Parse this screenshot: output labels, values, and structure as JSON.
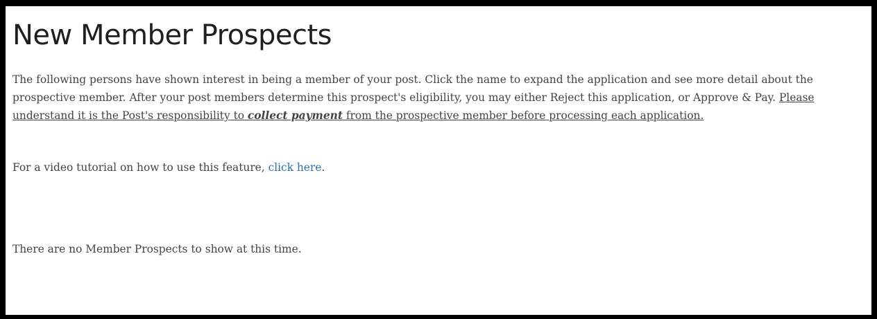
{
  "page": {
    "title": "New Member Prospects",
    "intro_plain": "The following persons have shown interest in being a member of your post. Click the name to expand the application and see more detail about the prospective member. After your post members determine this prospect's eligibility, you may either Reject this application, or Approve & Pay. ",
    "intro_underline_before": "Please understand it is the Post's responsibility to ",
    "intro_emphasis": "collect payment",
    "intro_underline_after": " from the prospective member before processing each application.",
    "tutorial_prefix": "For a video tutorial on how to use this feature, ",
    "tutorial_link": "click here",
    "tutorial_suffix": ".",
    "empty_message": "There are no Member Prospects to show at this time."
  },
  "colors": {
    "frame_border": "#000000",
    "background": "#ffffff",
    "body_text": "#444444",
    "heading_text": "#1f1f1f",
    "link": "#2f6fae"
  }
}
